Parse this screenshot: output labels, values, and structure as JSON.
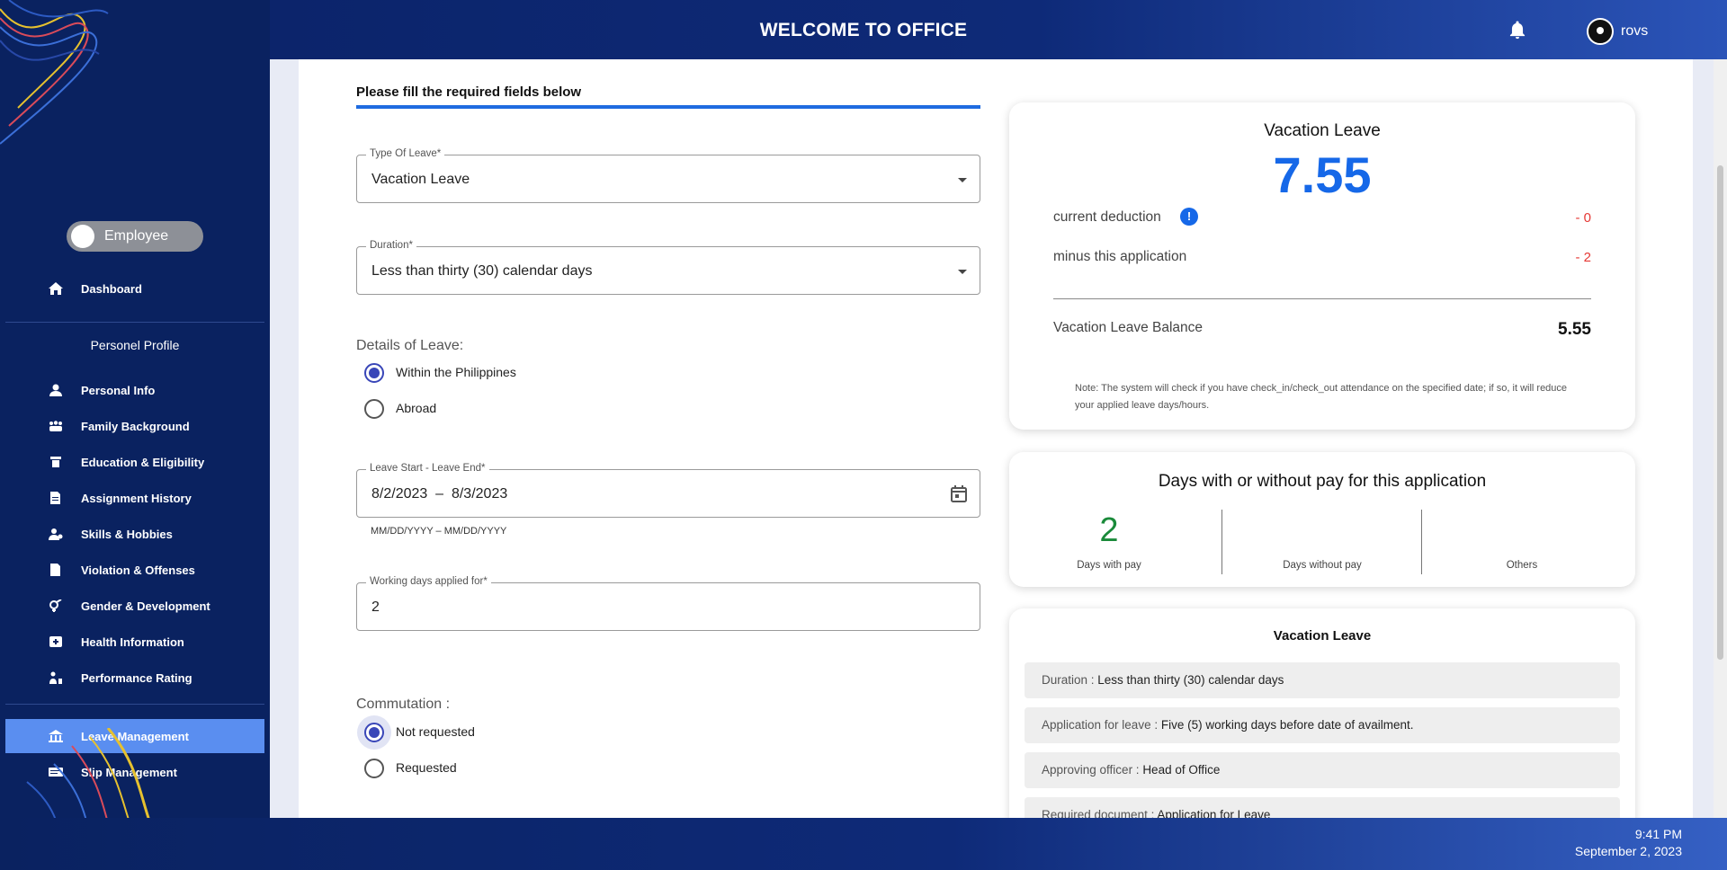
{
  "header": {
    "title": "WELCOME TO OFFICE",
    "username": "rovs"
  },
  "sidebar": {
    "role_toggle": "Employee",
    "dashboard": "Dashboard",
    "section_title": "Personel Profile",
    "items": [
      {
        "label": "Personal Info",
        "icon": "person-icon"
      },
      {
        "label": "Family Background",
        "icon": "family-icon"
      },
      {
        "label": "Education & Eligibility",
        "icon": "education-icon"
      },
      {
        "label": "Assignment History",
        "icon": "assignment-icon"
      },
      {
        "label": "Skills & Hobbies",
        "icon": "skills-icon"
      },
      {
        "label": "Violation & Offenses",
        "icon": "violation-icon"
      },
      {
        "label": "Gender & Development",
        "icon": "gender-icon"
      },
      {
        "label": "Health Information",
        "icon": "health-icon"
      },
      {
        "label": "Performance Rating",
        "icon": "performance-icon"
      }
    ],
    "leave_management": "Leave Management",
    "slip_management": "Slip Management"
  },
  "form": {
    "heading": "Please fill the required fields below",
    "type_of_leave": {
      "label": "Type Of Leave*",
      "value": "Vacation Leave"
    },
    "duration": {
      "label": "Duration*",
      "value": "Less than thirty (30) calendar days"
    },
    "details": {
      "label": "Details of Leave:",
      "options": [
        "Within the Philippines",
        "Abroad"
      ],
      "selected": "Within the Philippines"
    },
    "date_range": {
      "label": "Leave Start - Leave End*",
      "value": "8/2/2023  –  8/3/2023",
      "hint": "MM/DD/YYYY – MM/DD/YYYY"
    },
    "working_days": {
      "label": "Working days applied for*",
      "value": "2"
    },
    "commutation": {
      "label": "Commutation :",
      "options": [
        "Not requested",
        "Requested"
      ],
      "selected": "Not requested"
    }
  },
  "balance_card": {
    "title": "Vacation Leave",
    "current_balance": "7.55",
    "current_deduction_label": "current deduction",
    "current_deduction_value": "- 0",
    "minus_label": "minus this application",
    "minus_value": "- 2",
    "balance_label": "Vacation Leave Balance",
    "balance_value": "5.55",
    "note": "Note: The system will check if you have check_in/check_out attendance on the specified date; if so, it will reduce your applied leave days/hours."
  },
  "pay_card": {
    "title": "Days with or without pay for this application",
    "columns": [
      {
        "value": "2",
        "label": "Days with pay"
      },
      {
        "value": "",
        "label": "Days without pay"
      },
      {
        "value": "",
        "label": "Others"
      }
    ]
  },
  "info_card": {
    "title": "Vacation Leave",
    "rows": [
      {
        "key": "Duration : ",
        "value": "Less than thirty (30) calendar days"
      },
      {
        "key": "Application for leave : ",
        "value": "Five (5) working days before date of availment."
      },
      {
        "key": "Approving officer : ",
        "value": "Head of Office"
      },
      {
        "key": "Required document : ",
        "value": "Application for Leave"
      }
    ]
  },
  "footer": {
    "time": "9:41 PM",
    "date": "September 2, 2023"
  },
  "colors": {
    "accent": "#1668e8",
    "sidebar": "#0a2260",
    "active_nav": "#5a8ef0",
    "deduction": "#e53935",
    "with_pay": "#1a8a3a"
  }
}
